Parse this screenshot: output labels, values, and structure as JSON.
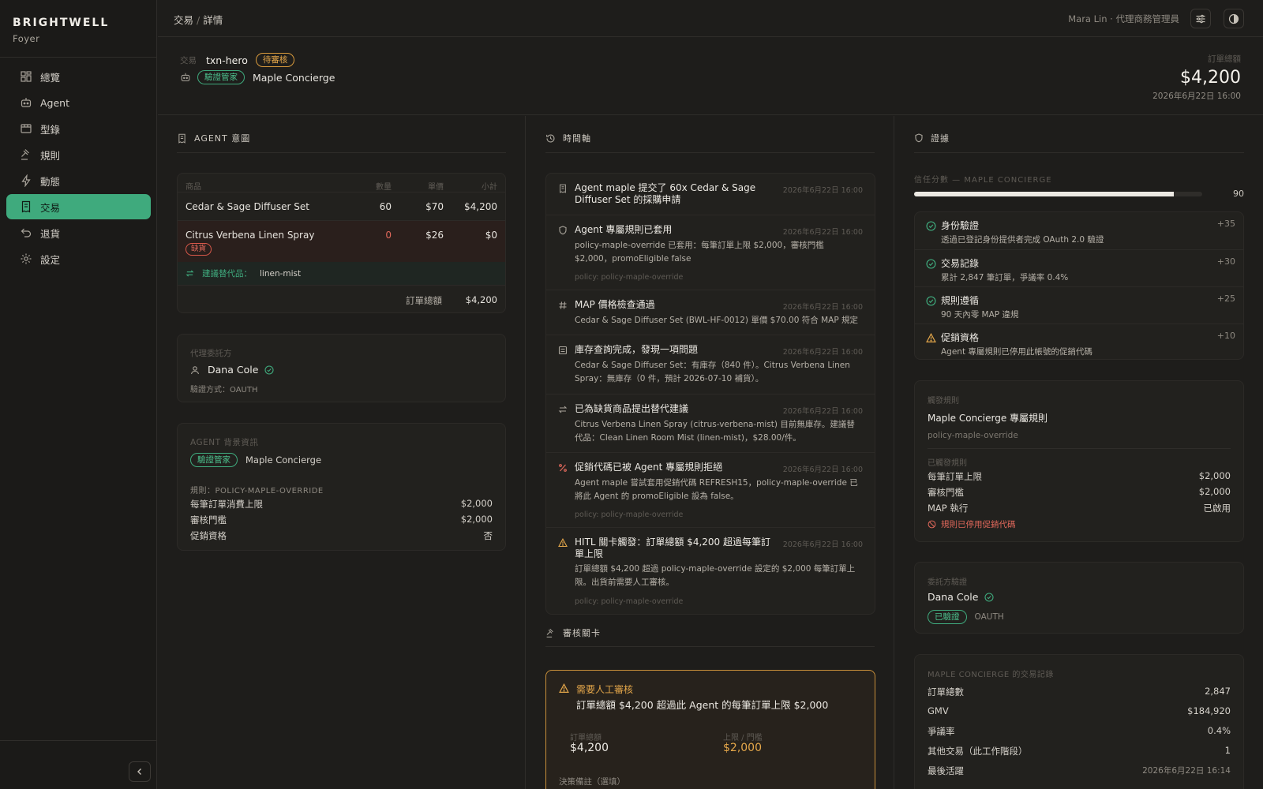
{
  "brand": {
    "name": "BRIGHTWELL",
    "sub": "Foyer"
  },
  "nav": [
    {
      "label": "總覽",
      "icon": "dashboard-icon"
    },
    {
      "label": "Agent",
      "icon": "robot-icon"
    },
    {
      "label": "型錄",
      "icon": "catalog-icon"
    },
    {
      "label": "規則",
      "icon": "gavel-icon"
    },
    {
      "label": "動態",
      "icon": "bolt-icon"
    },
    {
      "label": "交易",
      "icon": "receipt-icon",
      "active": true
    },
    {
      "label": "退貨",
      "icon": "return-icon"
    },
    {
      "label": "設定",
      "icon": "gear-icon"
    }
  ],
  "topbar": {
    "crumb_parent": "交易",
    "crumb_sep": "/",
    "crumb_current": "詳情",
    "user": "Mara Lin · 代理商務管理員"
  },
  "header": {
    "txn_label": "交易",
    "txn_id": "txn-hero",
    "status": "待審核",
    "agent_badge": "驗證管家",
    "agent_name": "Maple Concierge",
    "total_label": "訂單總額",
    "total": "$4,200",
    "date": "2026年6月22日 16:00"
  },
  "intent": {
    "title": "AGENT 意圖",
    "columns": {
      "product": "商品",
      "qty": "數量",
      "price": "單價",
      "subtotal": "小計"
    },
    "rows": [
      {
        "product": "Cedar & Sage Diffuser Set",
        "qty": "60",
        "price": "$70",
        "subtotal": "$4,200"
      },
      {
        "product": "Citrus Verbena Linen Spray",
        "qty": "0",
        "price": "$26",
        "subtotal": "$0",
        "badge": "缺貨"
      }
    ],
    "suggest_label": "建議替代品：",
    "suggest_value": "linen-mist",
    "total_label": "訂單總額",
    "total": "$4,200"
  },
  "principal": {
    "label": "代理委託方",
    "name": "Dana Cole",
    "auth": "驗證方式：OAUTH"
  },
  "agent_info": {
    "label": "AGENT 背景資訊",
    "badge": "驗證管家",
    "name": "Maple Concierge",
    "policy": "規則：POLICY-MAPLE-OVERRIDE",
    "rows": [
      {
        "k": "每筆訂單消費上限",
        "v": "$2,000"
      },
      {
        "k": "審核門檻",
        "v": "$2,000"
      },
      {
        "k": "促銷資格",
        "v": "否"
      }
    ]
  },
  "timeline": {
    "title": "時間軸",
    "items": [
      {
        "icon": "receipt-icon",
        "title": "Agent maple 提交了 60x Cedar & Sage Diffuser Set 的採購申請",
        "time": "2026年6月22日 16:00"
      },
      {
        "icon": "shield-icon",
        "title": "Agent 專屬規則已套用",
        "time": "2026年6月22日 16:00",
        "desc": "policy-maple-override 已套用：每筆訂單上限 $2,000，審核門檻 $2,000，promoEligible false",
        "policy": "policy: policy-maple-override"
      },
      {
        "icon": "hash-icon",
        "title": "MAP 價格檢查通過",
        "time": "2026年6月22日 16:00",
        "desc": "Cedar & Sage Diffuser Set (BWL-HF-0012) 單價 $70.00 符合 MAP 規定"
      },
      {
        "icon": "inventory-icon",
        "title": "庫存查詢完成，發現一項問題",
        "time": "2026年6月22日 16:00",
        "desc": "Cedar & Sage Diffuser Set：有庫存（840 件）。Citrus Verbena Linen Spray：無庫存（0 件，預計 2026-07-10 補貨）。"
      },
      {
        "icon": "swap-icon",
        "title": "已為缺貨商品提出替代建議",
        "time": "2026年6月22日 16:00",
        "desc": "Citrus Verbena Linen Spray (citrus-verbena-mist) 目前無庫存。建議替代品：Clean Linen Room Mist (linen-mist)，$28.00/件。"
      },
      {
        "icon": "percent-icon",
        "title": "促銷代碼已被 Agent 專屬規則拒絕",
        "time": "2026年6月22日 16:00",
        "desc": "Agent maple 嘗試套用促銷代碼 REFRESH15，policy-maple-override 已將此 Agent 的 promoEligible 設為 false。",
        "policy": "policy: policy-maple-override"
      },
      {
        "icon": "warning-icon",
        "title": "HITL 關卡觸發：訂單總額 $4,200 超過每筆訂單上限",
        "time": "2026年6月22日 16:00",
        "desc": "訂單總額 $4,200 超過 policy-maple-override 設定的 $2,000 每筆訂單上限。出貨前需要人工審核。",
        "policy": "policy: policy-maple-override"
      }
    ]
  },
  "review": {
    "title": "審核關卡",
    "heading": "需要人工審核",
    "message": "訂單總額 $4,200 超過此 Agent 的每筆訂單上限 $2,000",
    "total_label": "訂單總額",
    "total": "$4,200",
    "limit_label": "上限 / 門檻",
    "limit": "$2,000",
    "note_label": "決策備註（選填）"
  },
  "evidence": {
    "title": "證據",
    "trust_label": "信任分數 — MAPLE CONCIERGE",
    "trust_score": 90,
    "trust_max": 100,
    "items": [
      {
        "icon": "check-circle-icon",
        "title": "身份驗證",
        "desc": "透過已登記身份提供者完成 OAuth 2.0 驗證",
        "pts": "+35",
        "tone": "ok"
      },
      {
        "icon": "check-circle-icon",
        "title": "交易記錄",
        "desc": "累計 2,847 筆訂單，爭議率 0.4%",
        "pts": "+30",
        "tone": "ok"
      },
      {
        "icon": "check-circle-icon",
        "title": "規則遵循",
        "desc": "90 天內零 MAP 違規",
        "pts": "+25",
        "tone": "ok"
      },
      {
        "icon": "warning-icon",
        "title": "促銷資格",
        "desc": "Agent 專屬規則已停用此帳號的促銷代碼",
        "pts": "+10",
        "tone": "warn"
      }
    ],
    "rules": {
      "label": "觸發規則",
      "name": "Maple Concierge 專屬規則",
      "id": "policy-maple-override",
      "applied_label": "已觸發規則",
      "rows": [
        {
          "k": "每筆訂單上限",
          "v": "$2,000"
        },
        {
          "k": "審核門檻",
          "v": "$2,000"
        },
        {
          "k": "MAP 執行",
          "v": "已啟用"
        }
      ],
      "promo_note": "規則已停用促銷代碼"
    },
    "principal": {
      "label": "委託方驗證",
      "name": "Dana Cole",
      "badge": "已驗證",
      "method": "OAUTH"
    },
    "history": {
      "label": "MAPLE CONCIERGE 的交易記錄",
      "rows": [
        {
          "k": "訂單總數",
          "v": "2,847"
        },
        {
          "k": "GMV",
          "v": "$184,920"
        },
        {
          "k": "爭議率",
          "v": "0.4%"
        },
        {
          "k": "其他交易（此工作階段）",
          "v": "1"
        },
        {
          "k": "最後活躍",
          "v": "2026年6月22日 16:14"
        }
      ]
    }
  },
  "colors": {
    "accent": "#3faa7d",
    "warning": "#e4a74a",
    "danger": "#e0685b",
    "bg": "#1e1d1b"
  }
}
